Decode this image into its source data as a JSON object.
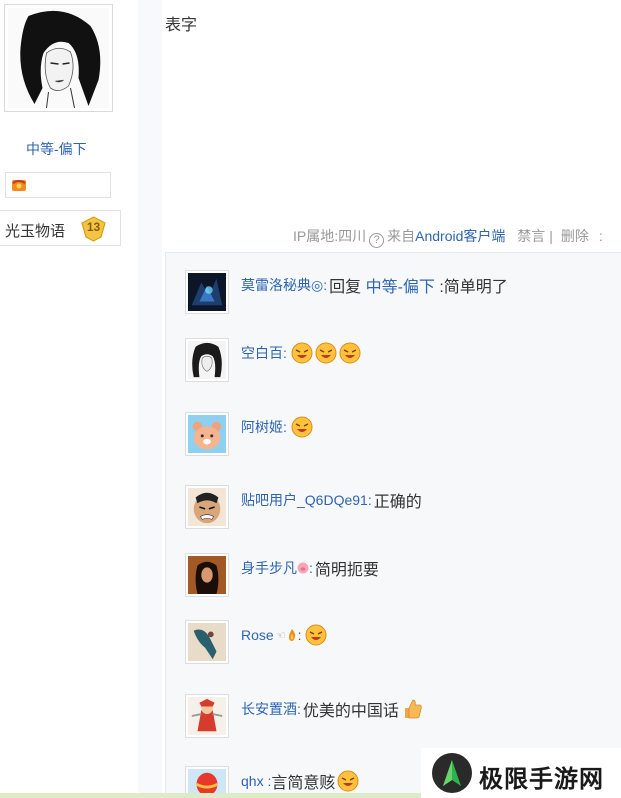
{
  "author": {
    "name": "中等-偏下",
    "forum_level": {
      "name": "光玉物语",
      "level": "13"
    }
  },
  "post": {
    "text": "表字",
    "meta": {
      "ip": "IP属地:四川",
      "from_prefix": "来自",
      "client": "Android客户端",
      "ban": "禁言",
      "separator": "|",
      "delete": "删除",
      "trailing": ":"
    }
  },
  "replies": [
    {
      "user": "莫雷洛秘典◎",
      "text_prefix": "回复 ",
      "mention": "中等-偏下",
      "text": " :简单明了",
      "emoji_count": 0,
      "avatar": "dark-fantasy-avatar"
    },
    {
      "user": "空白百",
      "text": "",
      "emoji_count": 3,
      "avatar": "girl-sketch-avatar"
    },
    {
      "user": "阿树姬",
      "text": "",
      "emoji_count": 1,
      "avatar": "bear-avatar"
    },
    {
      "user": "贴吧用户_Q6DQe91",
      "text": "正确的",
      "emoji_count": 0,
      "avatar": "manga-face-avatar"
    },
    {
      "user": "身手步凡",
      "text": "简明扼要",
      "emoji_count": 0,
      "avatar": "dark-portrait-avatar",
      "badge": "pig-icon"
    },
    {
      "user": "Rose",
      "text": "",
      "emoji_count": 1,
      "avatar": "dancer-avatar",
      "badge": "hand-flame-icon"
    },
    {
      "user": "长安置酒",
      "text": "优美的中国话",
      "emoji_count": 0,
      "thumb": true,
      "avatar": "red-warrior-avatar"
    },
    {
      "user": "qhx : ",
      "text": "言简意赅",
      "emoji_count": 1,
      "avatar": "hot-air-balloon-avatar"
    }
  ],
  "watermark": {
    "text": "极限手游网"
  },
  "colors": {
    "link": "#2d64b3",
    "meta": "#999999",
    "panel": "#f7f8fa"
  }
}
